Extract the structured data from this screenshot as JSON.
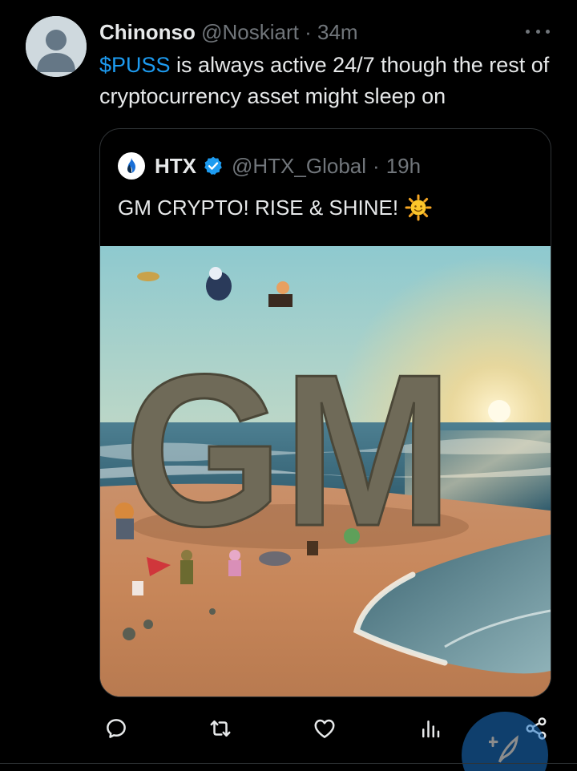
{
  "post": {
    "author_name": "Chinonso",
    "author_handle": "@Noskiart",
    "separator": "·",
    "time": "34m",
    "cashtag": "$PUSS",
    "text": " is always active 24/7 though the rest of cryptocurrency asset might sleep on"
  },
  "quoted": {
    "author_name": "HTX",
    "author_handle": "@HTX_Global",
    "separator": "·",
    "time": "19h",
    "text": "GM CRYPTO! RISE & SHINE!",
    "image_text": "GM",
    "image_description_icon": "beach-sunrise-image"
  },
  "actions": [
    {
      "name": "reply-icon"
    },
    {
      "name": "retweet-icon"
    },
    {
      "name": "like-icon"
    },
    {
      "name": "views-icon"
    },
    {
      "name": "share-icon"
    }
  ],
  "colors": {
    "accent": "#1d9bf0",
    "muted": "#71767b",
    "text": "#e7e9ea",
    "background": "#000000",
    "border": "#2f3336"
  }
}
